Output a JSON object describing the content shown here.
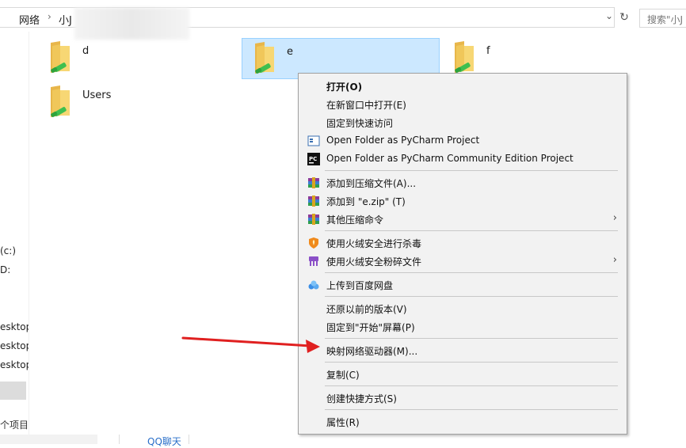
{
  "address": {
    "crumbs": [
      "网络",
      "小J"
    ],
    "separator": "›",
    "search_placeholder": "搜索\"小J",
    "dropdown_icon": "chevron-down-icon",
    "refresh_icon": "refresh-icon"
  },
  "nav": {
    "items": [
      "(c:)",
      "D:",
      "esktop",
      "esktop",
      "esktop"
    ],
    "status": "个项目"
  },
  "bottom": {
    "qq_label": "QQ聊天"
  },
  "folders": [
    {
      "name": "d",
      "selected": false
    },
    {
      "name": "e",
      "selected": true
    },
    {
      "name": "f",
      "selected": false
    },
    {
      "name": "Users",
      "selected": false
    }
  ],
  "context_menu": {
    "items": [
      {
        "label": "打开(O)",
        "bold": true,
        "icon": ""
      },
      {
        "label": "在新窗口中打开(E)",
        "icon": ""
      },
      {
        "label": "固定到快速访问",
        "icon": ""
      },
      {
        "label": "Open Folder as PyCharm Project",
        "icon": "pycharm-project-icon"
      },
      {
        "label": "Open Folder as PyCharm Community Edition Project",
        "icon": "pycharm-ce-icon"
      },
      {
        "label": "添加到压缩文件(A)...",
        "icon": "archive-icon"
      },
      {
        "label": "添加到 \"e.zip\" (T)",
        "icon": "archive-icon"
      },
      {
        "label": "其他压缩命令",
        "icon": "archive-icon",
        "submenu": true
      },
      {
        "label": "使用火绒安全进行杀毒",
        "icon": "huorong-shield-icon"
      },
      {
        "label": "使用火绒安全粉碎文件",
        "icon": "shredder-icon",
        "submenu": true
      },
      {
        "label": "上传到百度网盘",
        "icon": "baidu-cloud-icon"
      },
      {
        "label": "还原以前的版本(V)",
        "icon": ""
      },
      {
        "label": "固定到\"开始\"屏幕(P)",
        "icon": ""
      },
      {
        "label": "映射网络驱动器(M)...",
        "icon": ""
      },
      {
        "label": "复制(C)",
        "icon": ""
      },
      {
        "label": "创建快捷方式(S)",
        "icon": ""
      },
      {
        "label": "属性(R)",
        "icon": ""
      }
    ],
    "submenu_arrow": "›"
  },
  "colors": {
    "selection_bg": "#cce8ff",
    "menu_bg": "#f2f2f2",
    "arrow_red": "#e02020"
  }
}
